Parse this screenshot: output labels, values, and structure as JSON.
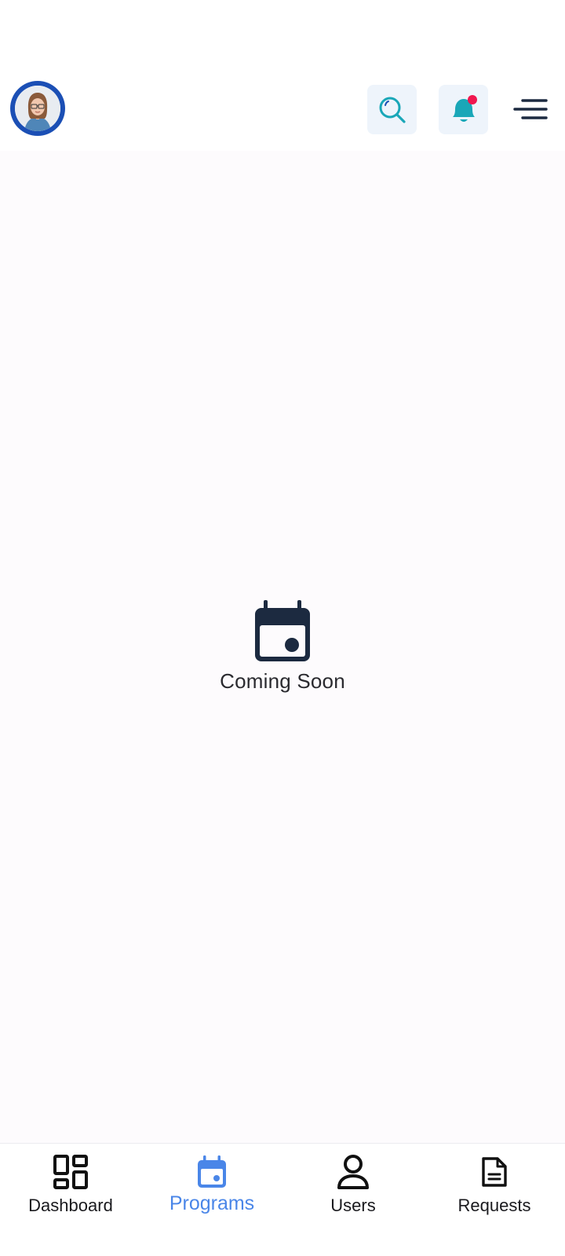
{
  "header": {
    "avatar_icon": "user-avatar",
    "search_icon": "search-icon",
    "notification_icon": "bell-icon",
    "menu_icon": "hamburger-menu-icon"
  },
  "main": {
    "empty_icon": "calendar-icon",
    "message": "Coming Soon"
  },
  "bottom_nav": {
    "items": [
      {
        "label": "Dashboard",
        "icon": "dashboard-icon",
        "active": false
      },
      {
        "label": "Programs",
        "icon": "calendar-icon",
        "active": true
      },
      {
        "label": "Users",
        "icon": "user-icon",
        "active": false
      },
      {
        "label": "Requests",
        "icon": "document-icon",
        "active": false
      }
    ]
  },
  "colors": {
    "accent": "#4a86e8",
    "teal": "#1aa7b8",
    "notification_dot": "#f0174f",
    "avatar_ring": "#1b4fb5",
    "icon_dark": "#1c2a40",
    "icon_button_bg": "#eef4fb"
  }
}
